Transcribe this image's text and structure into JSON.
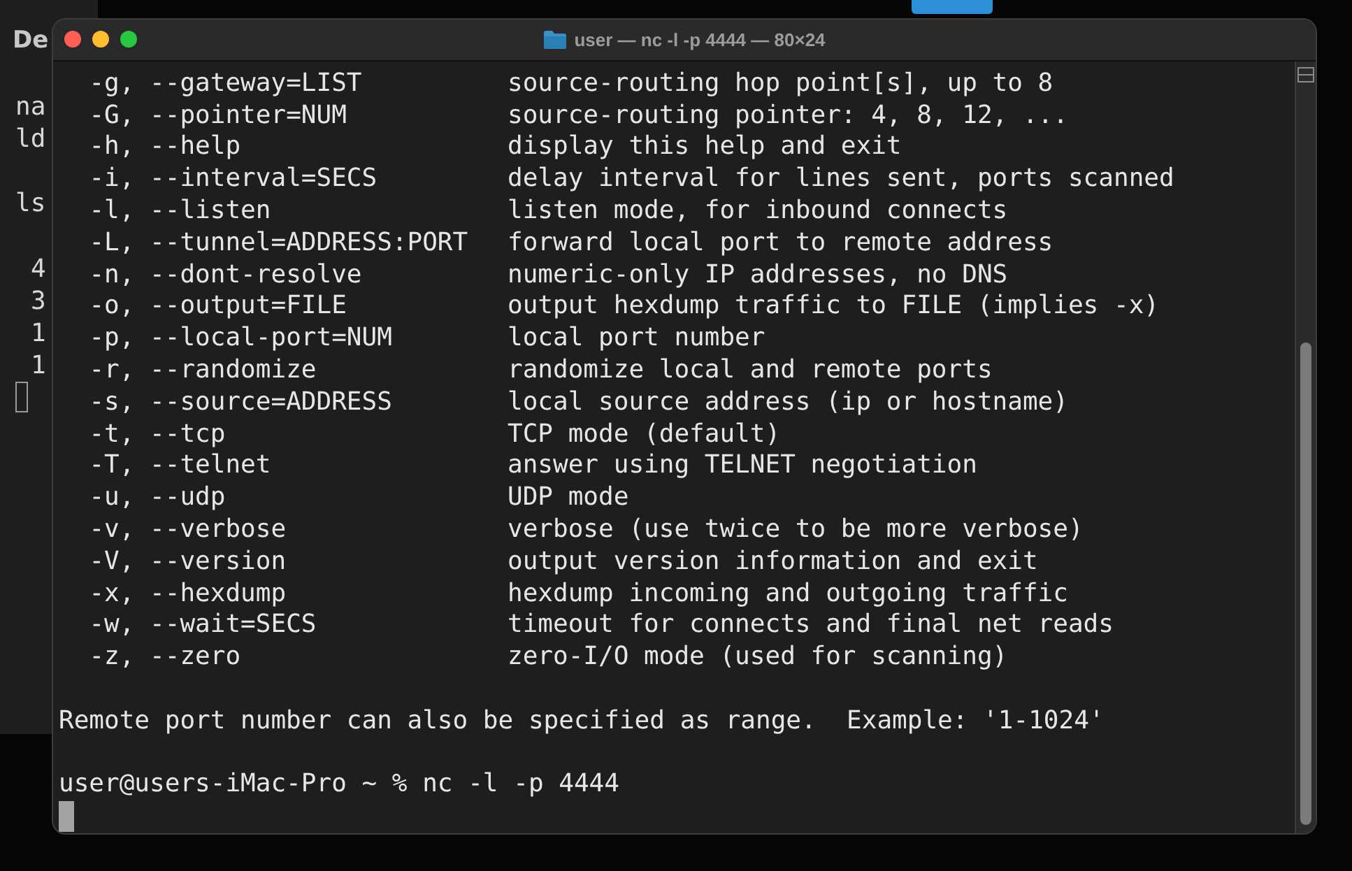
{
  "background_window": {
    "title": "De",
    "lines": [
      {
        "kind": "blank"
      },
      {
        "kind": "prompt",
        "text": "na"
      },
      {
        "kind": "prompt",
        "text": "ld"
      },
      {
        "kind": "blank"
      },
      {
        "kind": "prompt",
        "text": "ls"
      },
      {
        "kind": "blank"
      },
      {
        "kind": "output",
        "text": "4"
      },
      {
        "kind": "output",
        "text": "3"
      },
      {
        "kind": "output",
        "text": "1"
      },
      {
        "kind": "output",
        "text": "1"
      },
      {
        "kind": "cursor"
      }
    ]
  },
  "terminal": {
    "title": "user — nc -l -p 4444 — 80×24",
    "options": [
      {
        "flag": "-g, --gateway=LIST",
        "description": "source-routing hop point[s], up to 8"
      },
      {
        "flag": "-G, --pointer=NUM",
        "description": "source-routing pointer: 4, 8, 12, ..."
      },
      {
        "flag": "-h, --help",
        "description": "display this help and exit"
      },
      {
        "flag": "-i, --interval=SECS",
        "description": "delay interval for lines sent, ports scanned"
      },
      {
        "flag": "-l, --listen",
        "description": "listen mode, for inbound connects"
      },
      {
        "flag": "-L, --tunnel=ADDRESS:PORT",
        "description": "forward local port to remote address"
      },
      {
        "flag": "-n, --dont-resolve",
        "description": "numeric-only IP addresses, no DNS"
      },
      {
        "flag": "-o, --output=FILE",
        "description": "output hexdump traffic to FILE (implies -x)"
      },
      {
        "flag": "-p, --local-port=NUM",
        "description": "local port number"
      },
      {
        "flag": "-r, --randomize",
        "description": "randomize local and remote ports"
      },
      {
        "flag": "-s, --source=ADDRESS",
        "description": "local source address (ip or hostname)"
      },
      {
        "flag": "-t, --tcp",
        "description": "TCP mode (default)"
      },
      {
        "flag": "-T, --telnet",
        "description": "answer using TELNET negotiation"
      },
      {
        "flag": "-u, --udp",
        "description": "UDP mode"
      },
      {
        "flag": "-v, --verbose",
        "description": "verbose (use twice to be more verbose)"
      },
      {
        "flag": "-V, --version",
        "description": "output version information and exit"
      },
      {
        "flag": "-x, --hexdump",
        "description": "hexdump incoming and outgoing traffic"
      },
      {
        "flag": "-w, --wait=SECS",
        "description": "timeout for connects and final net reads"
      },
      {
        "flag": "-z, --zero",
        "description": "zero-I/O mode (used for scanning)"
      }
    ],
    "note": "Remote port number can also be specified as range.  Example: '1-1024'",
    "prompt": "user@users-iMac-Pro ~ % nc -l -p 4444"
  }
}
